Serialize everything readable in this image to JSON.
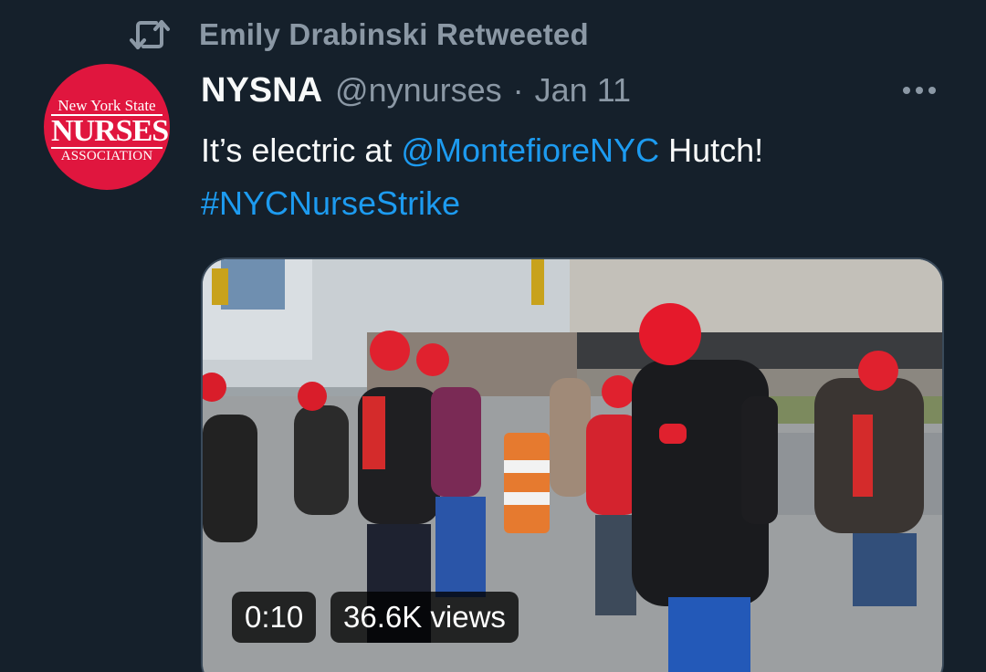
{
  "retweet": {
    "icon": "retweet-icon",
    "text": "Emily Drabinski Retweeted"
  },
  "author": {
    "display_name": "NYSNA",
    "handle": "@nynurses",
    "separator": "·",
    "date": "Jan 11",
    "avatar": {
      "line1": "New York State",
      "line2": "NURSES",
      "line3": "ASSOCIATION",
      "color": "#e0163e"
    }
  },
  "tweet": {
    "text_before": "It’s electric at ",
    "mention": "@MontefioreNYC",
    "text_after": " Hutch!",
    "hashtag": "#NYCNurseStrike"
  },
  "video": {
    "duration": "0:10",
    "views": "36.6K views"
  },
  "colors": {
    "background": "#15202b",
    "link": "#1d9bf0",
    "muted": "#8b98a5",
    "text": "#f7f9f9"
  }
}
